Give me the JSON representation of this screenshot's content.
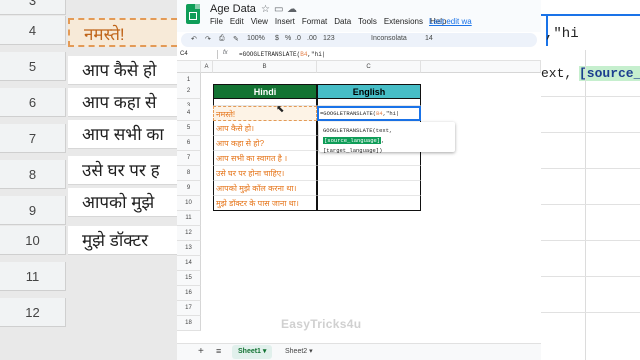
{
  "doc": {
    "title": "Age Data",
    "menu": [
      "File",
      "Edit",
      "View",
      "Insert",
      "Format",
      "Data",
      "Tools",
      "Extensions",
      "Help"
    ],
    "last_edit": "Last edit wa",
    "star_icon": "star-icon",
    "folder_icon": "folder-icon",
    "cloud_icon": "cloud-icon"
  },
  "toolbar": {
    "undo": "↶",
    "redo": "↷",
    "print": "⎙",
    "paint": "✎",
    "zoom": "100%",
    "currency": "$",
    "percent": "%",
    "decimal_dec": ".0",
    "decimal_inc": ".00",
    "number_format": "123",
    "font": "Inconsolata",
    "font_size": "14"
  },
  "formula_bar": {
    "cell_ref": "C4",
    "fx": "fx",
    "formula_prefix": "=GOOGLETRANSLATE(",
    "formula_ref": "B4",
    "formula_suffix": ",\"hi|"
  },
  "columns": [
    "A",
    "B",
    "C"
  ],
  "rows": [
    "1",
    "2",
    "3",
    "4",
    "5",
    "6",
    "7",
    "8",
    "9",
    "10",
    "11",
    "12",
    "13",
    "14",
    "15",
    "16",
    "17",
    "18"
  ],
  "table": {
    "header_hindi": "Hindi",
    "header_english": "English",
    "hindi": [
      "नमस्ते!",
      "आप कैसे हो।",
      "आप कहा से हो?",
      "आप सभी का स्वागत है ।",
      "उसे घर पर होना चाहिए।",
      "आपको मुझे कॉल करना था।",
      "मुझे डॉक्टर के पास जाना था।"
    ],
    "active_formula_prefix": "=GOOGLETRANSLATE(",
    "active_formula_ref": "B4",
    "active_formula_suffix": ",\"hi|"
  },
  "tooltip": {
    "line1_prefix": "GOOGLETRANSLATE(text, ",
    "line1_highlight": "[source_language]",
    "line1_suffix": ",",
    "line2": "[target_language])"
  },
  "background": {
    "row_numbers": [
      "3",
      "4",
      "5",
      "6",
      "7",
      "8",
      "9",
      "10",
      "11",
      "12"
    ],
    "hindi_zoom": [
      "नमस्ते!",
      "आप कैसे हो",
      "आप कहा से",
      "आप सभी का",
      "उसे घर पर ह",
      "आपको मुझे",
      "मुझे डॉक्टर"
    ],
    "formula_tail": ",\"hi",
    "chip_text": "ext,",
    "chip_hl": "[source_language]"
  },
  "watermark": "EasyTricks4u",
  "tabs": {
    "add": "+",
    "all_sheets": "≡",
    "sheet1": "Sheet1 ▾",
    "sheet2": "Sheet2 ▾"
  }
}
